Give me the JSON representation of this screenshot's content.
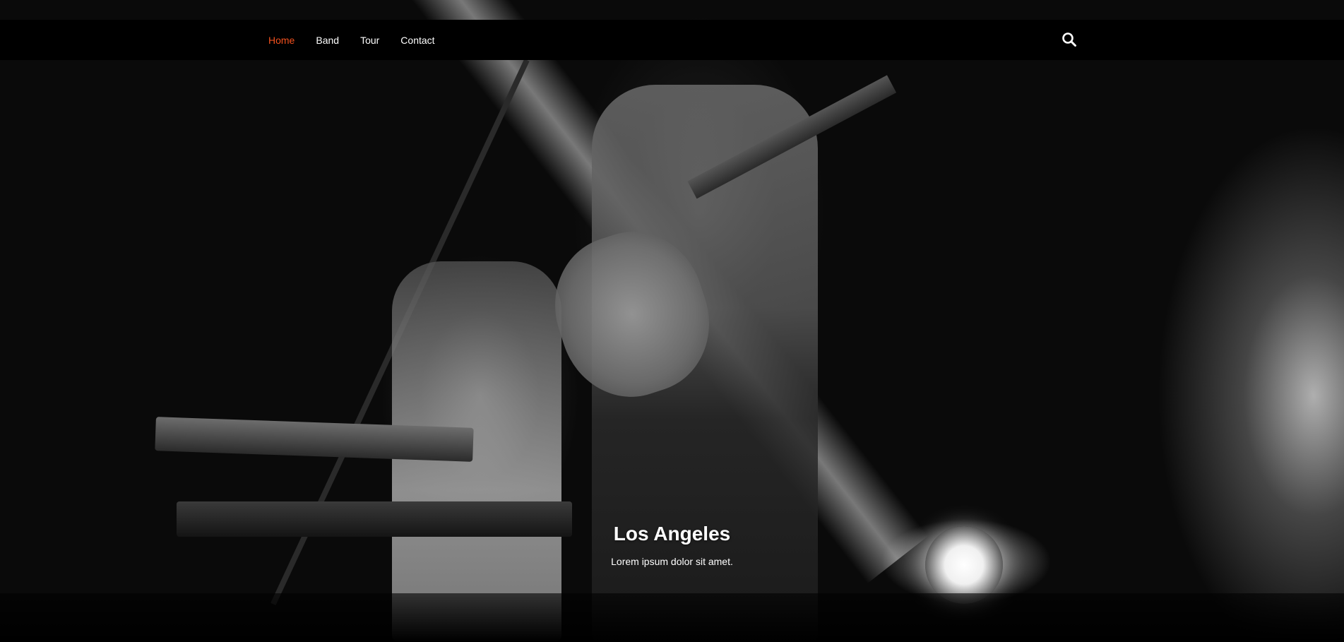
{
  "navbar": {
    "links": [
      {
        "label": "Home",
        "active": true
      },
      {
        "label": "Band",
        "active": false
      },
      {
        "label": "Tour",
        "active": false
      },
      {
        "label": "Contact",
        "active": false
      }
    ],
    "search_icon": "search-icon",
    "active_color": "#f4511e",
    "background_color": "#000000"
  },
  "hero": {
    "caption_title": "Los Angeles",
    "caption_text": "Lorem ipsum dolor sit amet."
  }
}
